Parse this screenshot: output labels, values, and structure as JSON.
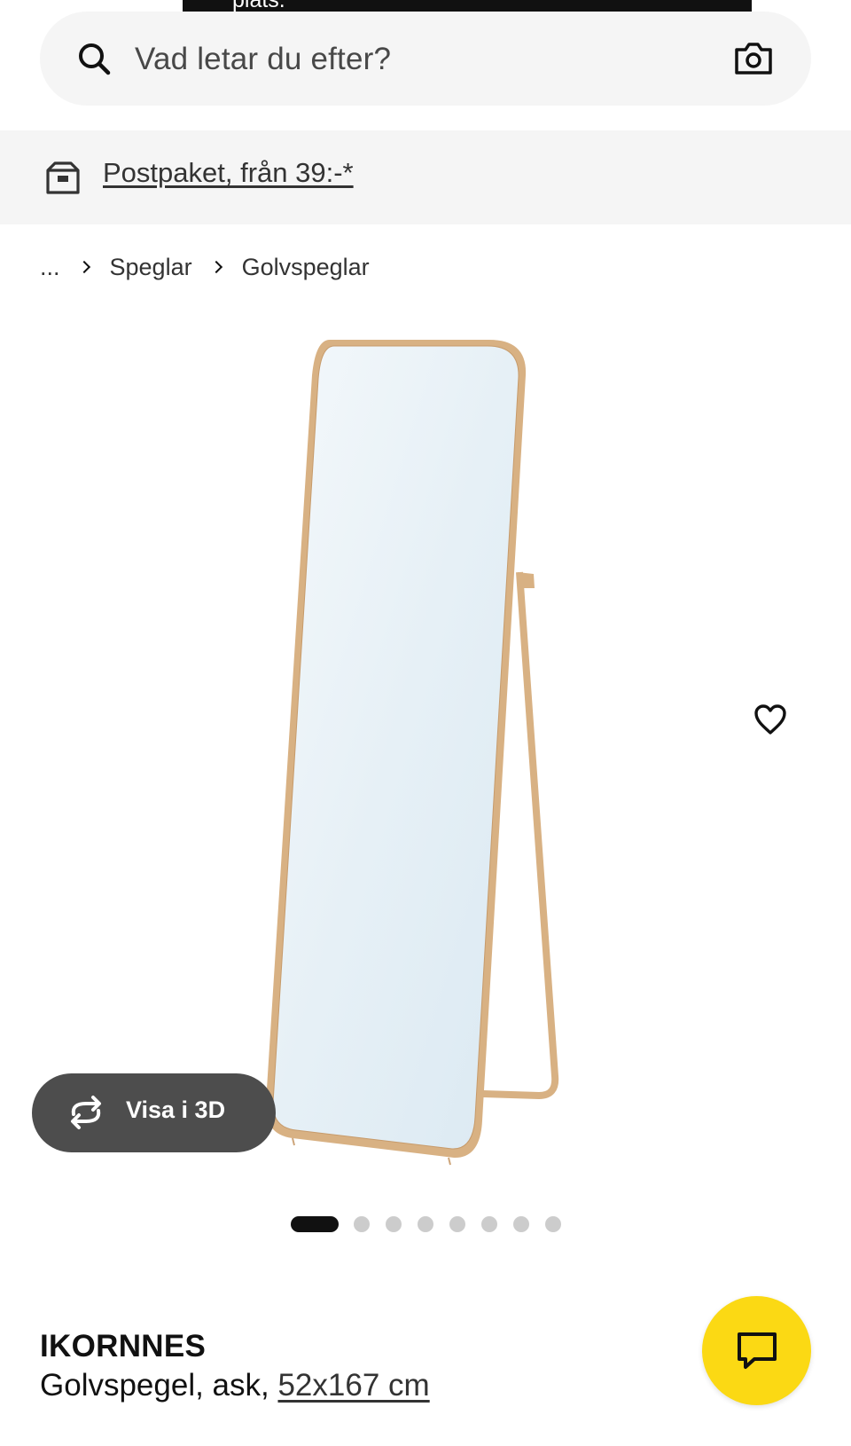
{
  "toast": {
    "text": "plats."
  },
  "search": {
    "placeholder": "Vad letar du efter?"
  },
  "promo": {
    "link_text": "Postpaket, från 39:-*"
  },
  "breadcrumb": {
    "ellipsis": "...",
    "items": [
      "Speglar",
      "Golvspeglar"
    ]
  },
  "gallery": {
    "image_count": 8,
    "active_index": 0,
    "view3d_label": "Visa i 3D"
  },
  "product": {
    "name": "IKORNNES",
    "description_prefix": "Golvspegel, ask, ",
    "size": "52x167 cm"
  },
  "colors": {
    "chat_button": "#fbd914",
    "promo_bg": "#f5f5f5",
    "frame_wood": "#d8b183",
    "dark_button": "#4d4d4d"
  },
  "icons": {
    "search": "search-icon",
    "camera": "camera-icon",
    "parcel": "parcel-icon",
    "favorite": "heart-icon",
    "rotate": "rotate-3d-icon",
    "chat": "chat-icon"
  }
}
